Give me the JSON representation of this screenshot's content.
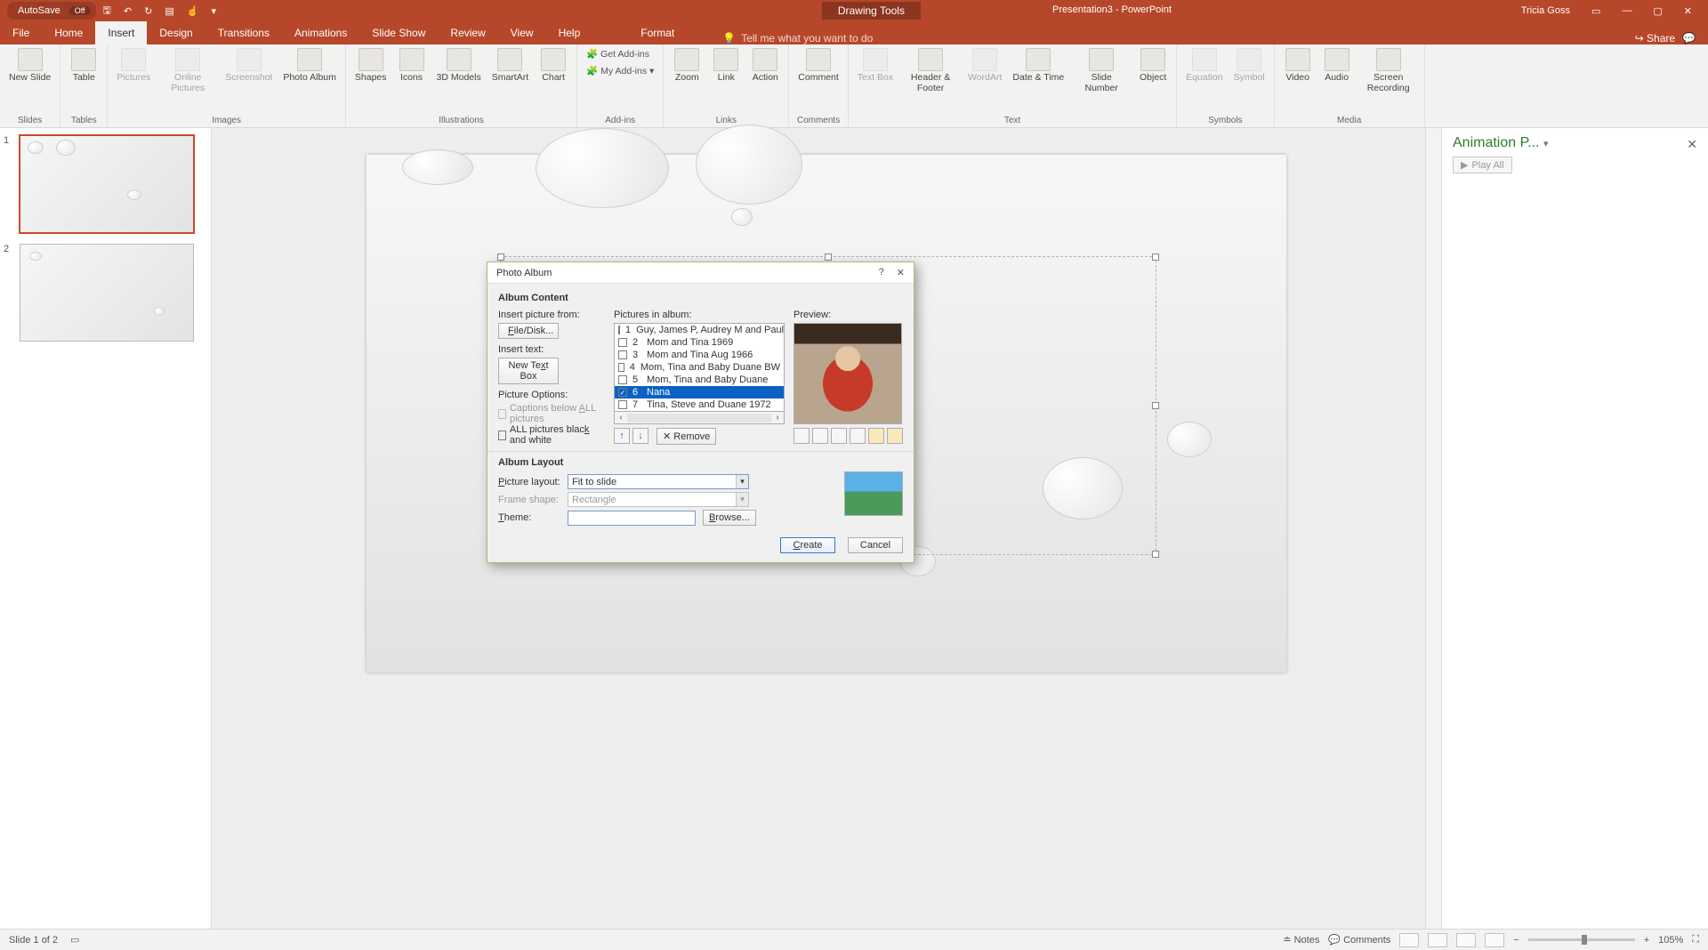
{
  "titlebar": {
    "autosave_label": "AutoSave",
    "autosave_state": "Off",
    "context_tab": "Drawing Tools",
    "doc_title": "Presentation3 - PowerPoint",
    "user": "Tricia Goss"
  },
  "tabs": {
    "file": "File",
    "home": "Home",
    "insert": "Insert",
    "design": "Design",
    "transitions": "Transitions",
    "animations": "Animations",
    "slideshow": "Slide Show",
    "review": "Review",
    "view": "View",
    "help": "Help",
    "format": "Format",
    "tellme": "Tell me what you want to do",
    "share": "Share"
  },
  "ribbon": {
    "new_slide": "New\nSlide",
    "table": "Table",
    "pictures": "Pictures",
    "online_pictures": "Online\nPictures",
    "screenshot": "Screenshot",
    "photo_album": "Photo\nAlbum",
    "shapes": "Shapes",
    "icons": "Icons",
    "models3d": "3D\nModels",
    "smartart": "SmartArt",
    "chart": "Chart",
    "get_addins": "Get Add-ins",
    "my_addins": "My Add-ins",
    "zoom": "Zoom",
    "link": "Link",
    "action": "Action",
    "comment": "Comment",
    "text_box": "Text\nBox",
    "header_footer": "Header\n& Footer",
    "wordart": "WordArt",
    "date_time": "Date &\nTime",
    "slide_number": "Slide\nNumber",
    "object": "Object",
    "equation": "Equation",
    "symbol": "Symbol",
    "video": "Video",
    "audio": "Audio",
    "screen_rec": "Screen\nRecording",
    "groups": {
      "slides": "Slides",
      "tables": "Tables",
      "images": "Images",
      "illustrations": "Illustrations",
      "addins": "Add-ins",
      "links": "Links",
      "comments": "Comments",
      "text": "Text",
      "symbols": "Symbols",
      "media": "Media"
    }
  },
  "anim_pane": {
    "title": "Animation P...",
    "play_all": "Play All"
  },
  "dialog": {
    "title": "Photo Album",
    "album_content": "Album Content",
    "insert_from": "Insert picture from:",
    "file_disk": "File/Disk...",
    "insert_text": "Insert text:",
    "new_text_box": "New Text Box",
    "picture_options": "Picture Options:",
    "captions_below": "Captions below ALL pictures",
    "all_bw": "ALL pictures black and white",
    "pictures_in_album": "Pictures in album:",
    "preview": "Preview:",
    "remove": "Remove",
    "album_layout": "Album Layout",
    "picture_layout": "Picture layout:",
    "picture_layout_val": "Fit to slide",
    "frame_shape": "Frame shape:",
    "frame_shape_val": "Rectangle",
    "theme": "Theme:",
    "browse": "Browse...",
    "create": "Create",
    "cancel": "Cancel",
    "items": [
      {
        "n": "1",
        "name": "Guy, James P, Audrey M and Paul M Coll"
      },
      {
        "n": "2",
        "name": "Mom and Tina 1969"
      },
      {
        "n": "3",
        "name": "Mom and Tina Aug 1966"
      },
      {
        "n": "4",
        "name": "Mom, Tina and Baby Duane BW"
      },
      {
        "n": "5",
        "name": "Mom, Tina and Baby Duane"
      },
      {
        "n": "6",
        "name": "Nana"
      },
      {
        "n": "7",
        "name": "Tina, Steve and Duane 1972"
      }
    ],
    "selected_index": 5
  },
  "status": {
    "slide_of": "Slide 1 of 2",
    "notes": "Notes",
    "comments": "Comments",
    "zoom": "105%"
  }
}
